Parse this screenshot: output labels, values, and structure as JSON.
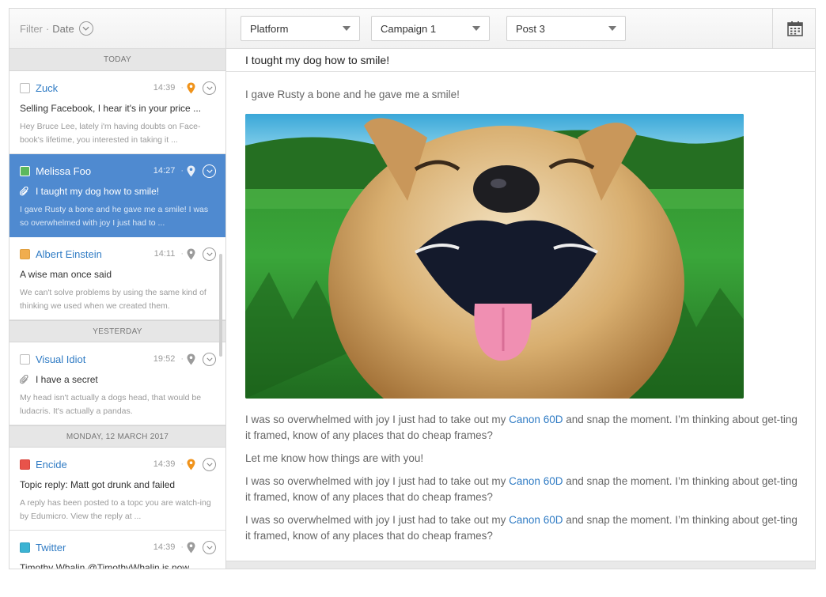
{
  "filter": {
    "label": "Filter",
    "separator": "·",
    "value": "Date"
  },
  "toolbar": {
    "platform": "Platform",
    "campaign": "Campaign 1",
    "post": "Post 3",
    "calendar_icon": "calendar-icon"
  },
  "groups": [
    {
      "header": "TODAY",
      "messages": [
        {
          "sender": "Zuck",
          "time": "14:39",
          "sep": "·",
          "checkbox_color": "#ffffff",
          "pin_color": "#f0931b",
          "attachment": false,
          "subject": "Selling Facebook, I hear it's in your price ...",
          "preview": "Hey Bruce Lee, lately i'm having doubts on Face-book's lifetime, you interested in taking it ..."
        },
        {
          "sender": "Melissa Foo",
          "time": "14:27",
          "sep": "·",
          "checkbox_color": "#5cb85c",
          "pin_color": "#ffffff",
          "attachment": true,
          "selected": true,
          "subject": "I taught my dog how to smile!",
          "preview": "I gave Rusty a bone and he gave me a smile! I was so overwhelmed with joy I just had to ..."
        },
        {
          "sender": "Albert Einstein",
          "time": "14:11",
          "sep": "·",
          "checkbox_color": "#f0ad4e",
          "pin_color": "#9b9b9b",
          "attachment": false,
          "subject": "A wise man once said",
          "preview": "We can't solve problems by using the same kind of thinking we used when we created them."
        }
      ]
    },
    {
      "header": "YESTERDAY",
      "messages": [
        {
          "sender": "Visual Idiot",
          "time": "19:52",
          "sep": "·",
          "checkbox_color": "#ffffff",
          "pin_color": "#9b9b9b",
          "attachment": true,
          "subject": "I have a secret",
          "preview": "My head isn't actually a dogs head, that would be ludacris. It's actually a pandas."
        }
      ]
    },
    {
      "header": "MONDAY, 12 MARCH 2017",
      "messages": [
        {
          "sender": "Encide",
          "time": "14:39",
          "sep": "·",
          "checkbox_color": "#e8534a",
          "pin_color": "#f0931b",
          "attachment": false,
          "subject": "Topic reply: Matt got drunk and failed",
          "preview": "A reply has been posted to a topc you are watch-ing by Edumicro. View the reply at ..."
        },
        {
          "sender": "Twitter",
          "time": "14:39",
          "sep": "·",
          "checkbox_color": "#3bb3d3",
          "pin_color": "#9b9b9b",
          "attachment": false,
          "subject": "Timothy Whalin @TimothyWhalin is now ...",
          "preview": ""
        }
      ]
    }
  ],
  "email": {
    "subject": "I tought my dog how to smile!",
    "intro": "I gave Rusty a bone and he gave me a smile!",
    "image_alt": "smiling-dog-photo",
    "para_before": "I was so overwhelmed with joy I just had to take out my ",
    "link": "Canon 60D",
    "para_after": " and snap the moment. I’m thinking about get-ting it framed, know of any places that do cheap frames?",
    "middle": "Let me know how things are with you!"
  },
  "colors": {
    "accent": "#4f8ad0",
    "link": "#2f7bc4"
  }
}
